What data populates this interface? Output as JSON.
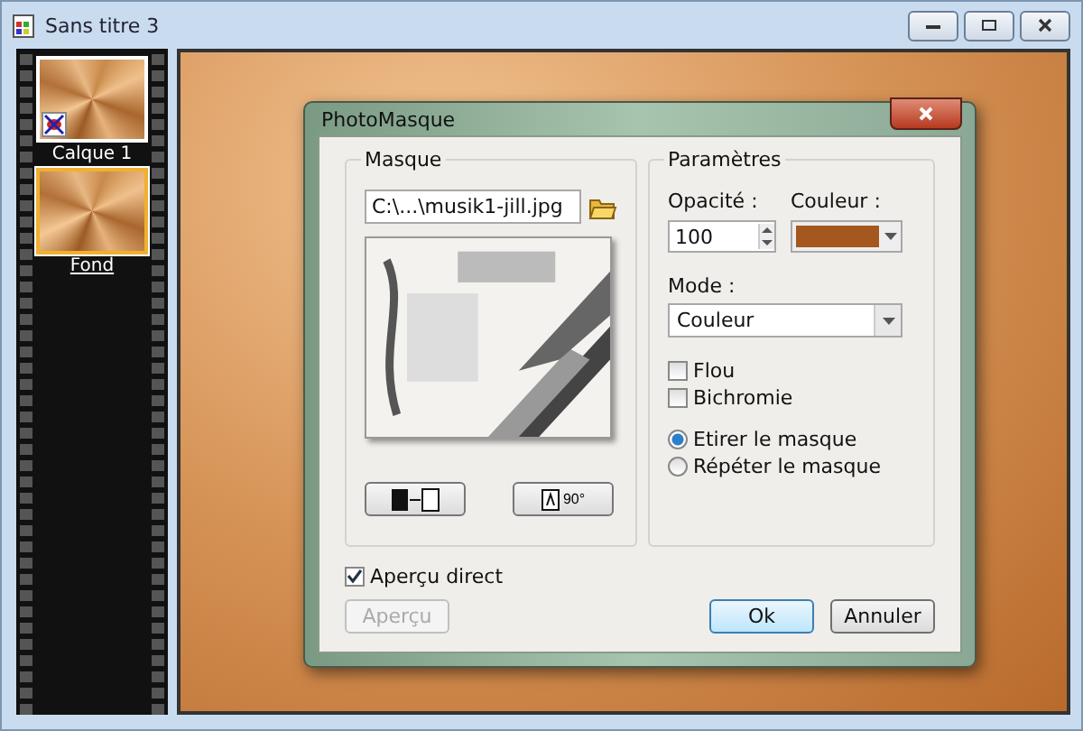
{
  "window": {
    "title": "Sans titre 3"
  },
  "layers": [
    {
      "name": "Calque 1",
      "selected": false,
      "masked": true
    },
    {
      "name": "Fond",
      "selected": true,
      "masked": false
    }
  ],
  "dialog": {
    "title": "PhotoMasque",
    "mask_group": {
      "title": "Masque",
      "file": "C:\\...\\musik1-jill.jpg",
      "rotate_label": "90°"
    },
    "params": {
      "title": "Paramètres",
      "opacity_label": "Opacité :",
      "opacity": "100",
      "color_label": "Couleur :",
      "color": "#a4581f",
      "mode_label": "Mode :",
      "mode": "Couleur",
      "checkboxes": [
        {
          "label": "Flou",
          "checked": false
        },
        {
          "label": "Bichromie",
          "checked": false
        }
      ],
      "radios": [
        {
          "label": "Etirer le masque",
          "selected": true
        },
        {
          "label": "Répéter le masque",
          "selected": false
        }
      ]
    },
    "live_preview": {
      "label": "Aperçu direct",
      "checked": true
    },
    "buttons": [
      {
        "label": "Aperçu",
        "disabled": true,
        "default": false,
        "kind": "left"
      },
      {
        "label": "Ok",
        "disabled": false,
        "default": true,
        "kind": "right"
      },
      {
        "label": "Annuler",
        "disabled": false,
        "default": false,
        "kind": "right"
      }
    ]
  }
}
